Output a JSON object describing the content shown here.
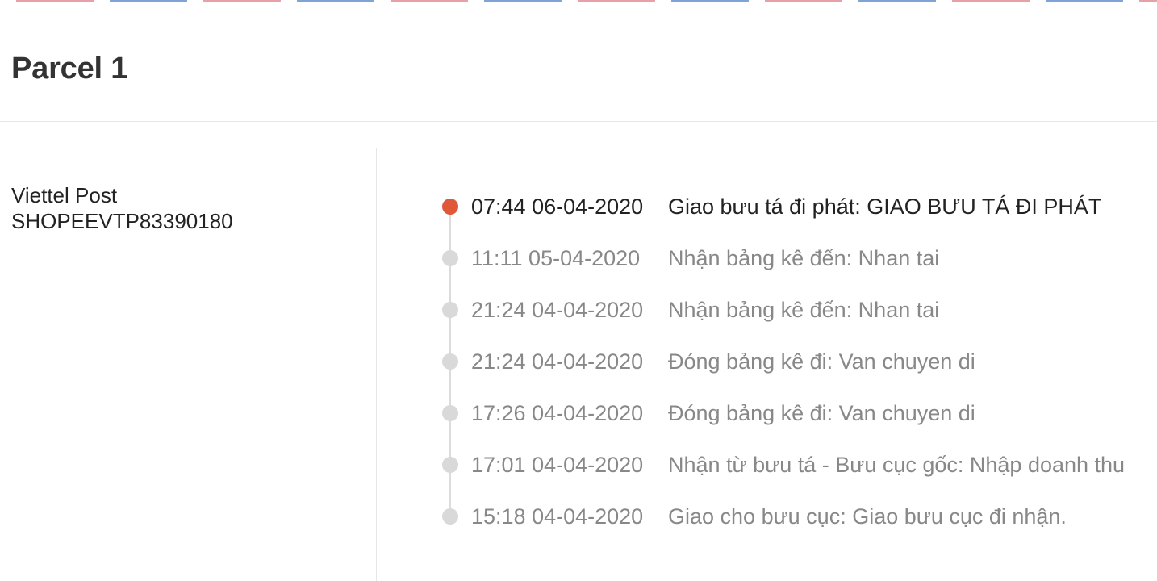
{
  "parcel": {
    "title": "Parcel 1",
    "carrier": "Viettel Post",
    "tracking_number": "SHOPEEVTP83390180"
  },
  "border_colors": [
    "#e8a0a8",
    "#7fa3d6"
  ],
  "timeline": {
    "active_color": "#e0583a",
    "inactive_color": "#d9d9d9",
    "events": [
      {
        "time": "07:44 06-04-2020",
        "description": "Giao bưu tá đi phát: GIAO BƯU TÁ ĐI PHÁT",
        "active": true
      },
      {
        "time": "11:11 05-04-2020",
        "description": "Nhận bảng kê đến: Nhan tai",
        "active": false
      },
      {
        "time": "21:24 04-04-2020",
        "description": "Nhận bảng kê đến: Nhan tai",
        "active": false
      },
      {
        "time": "21:24 04-04-2020",
        "description": "Đóng bảng kê đi: Van chuyen di",
        "active": false
      },
      {
        "time": "17:26 04-04-2020",
        "description": "Đóng bảng kê đi: Van chuyen di",
        "active": false
      },
      {
        "time": "17:01 04-04-2020",
        "description": "Nhận từ bưu tá - Bưu cục gốc: Nhập doanh thu",
        "active": false
      },
      {
        "time": "15:18 04-04-2020",
        "description": "Giao cho bưu cục: Giao bưu cục đi nhận.",
        "active": false
      }
    ]
  }
}
